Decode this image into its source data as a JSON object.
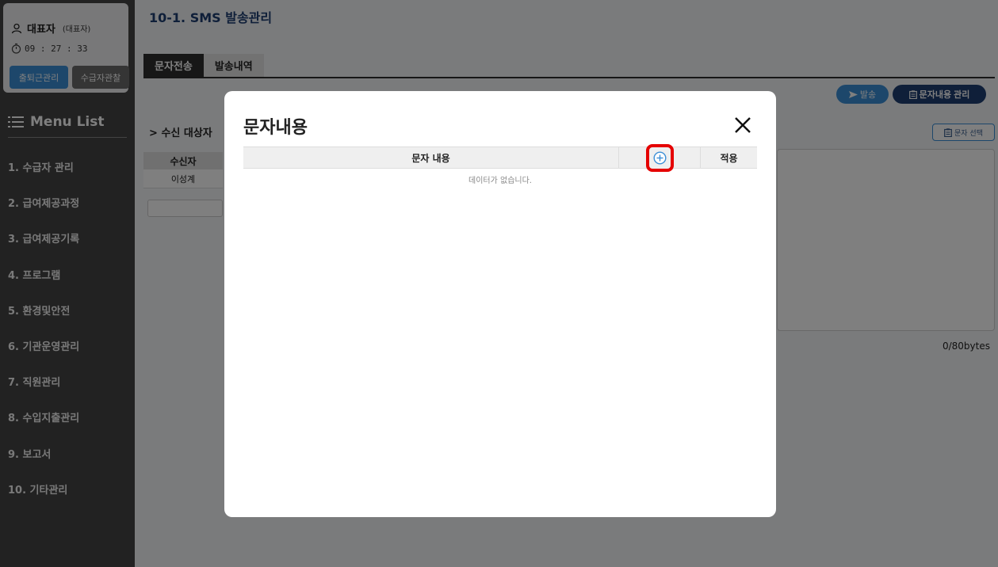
{
  "sidebar": {
    "user_name": "대표자",
    "user_role": "(대표자)",
    "timer": "09 : 27 : 33",
    "attendance_button": "출퇴근관리",
    "observe_button": "수급자관찰",
    "menu_title": "Menu List",
    "menu_items": [
      "1. 수급자 관리",
      "2. 급여제공과정",
      "3. 급여제공기록",
      "4. 프로그램",
      "5. 환경및안전",
      "6. 기관운영관리",
      "7. 직원관리",
      "8. 수입지출관리",
      "9. 보고서",
      "10. 기타관리"
    ]
  },
  "main": {
    "page_title": "10-1. SMS 발송관리",
    "tabs": [
      {
        "label": "문자전송",
        "active": true
      },
      {
        "label": "발송내역",
        "active": false
      }
    ],
    "send_button": "발송",
    "manage_button": "문자내용 관리",
    "select_button": "문자 선택",
    "recipients_title": "수신 대상자",
    "recipients_header": "수신자",
    "recipients": [
      "이성계"
    ],
    "bytes": "0/80bytes"
  },
  "modal": {
    "title": "문자내용",
    "columns": {
      "content": "문자 내용",
      "apply": "적용"
    },
    "empty_message": "데이터가 없습니다."
  },
  "colors": {
    "sidebar_bg": "#444444",
    "accent_blue": "#3b8fd6",
    "navy": "#1e3f73",
    "highlight_red": "#e50000"
  },
  "icons": {
    "user": "user-icon",
    "timer": "stopwatch-icon",
    "menu": "hamburger-icon",
    "send": "send-icon",
    "manage": "clipboard-icon",
    "close": "close-icon",
    "add": "plus-circle-icon"
  }
}
